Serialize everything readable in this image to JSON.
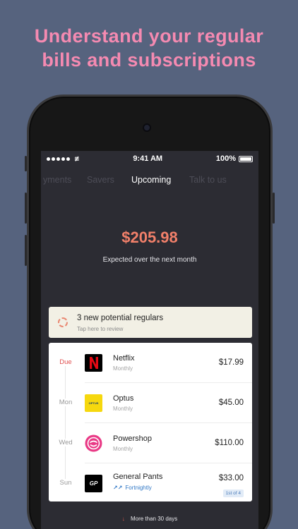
{
  "headline": {
    "line1": "Understand your regular",
    "line2": "bills and subscriptions"
  },
  "status_bar": {
    "time": "9:41 AM",
    "battery": "100%"
  },
  "tabs": [
    {
      "label": "Payments",
      "visible_text": "yments"
    },
    {
      "label": "Savers"
    },
    {
      "label": "Upcoming"
    },
    {
      "label": "Talk to us"
    }
  ],
  "summary": {
    "amount": "$205.98",
    "caption": "Expected over the next month"
  },
  "banner": {
    "title": "3 new potential regulars",
    "subtitle": "Tap here to review"
  },
  "payments": [
    {
      "day": "Due",
      "name": "Netflix",
      "frequency": "Monthly",
      "amount": "$17.99",
      "logo_text": "N"
    },
    {
      "day": "Mon",
      "name": "Optus",
      "frequency": "Monthly",
      "amount": "$45.00",
      "logo_text": "OPTUS"
    },
    {
      "day": "Wed",
      "name": "Powershop",
      "frequency": "Monthly",
      "amount": "$110.00"
    },
    {
      "day": "Sun",
      "name": "General Pants",
      "frequency": "Fortnightly",
      "amount": "$33.00",
      "logo_text": "GP",
      "badge": "1st of 4"
    }
  ],
  "footer": {
    "more_label": "More than 30 days"
  },
  "colors": {
    "background": "#56637e",
    "headline": "#f58ab1",
    "amount": "#f2806a",
    "due": "#e04f4f",
    "fortnightly": "#3178c6"
  }
}
